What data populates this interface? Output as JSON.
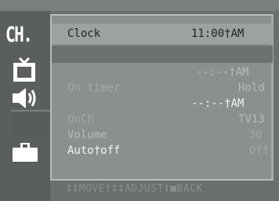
{
  "osd": {
    "category_icon_label": "CH.",
    "side_icons": [
      "tv-icon",
      "speaker-icon",
      "briefcase-icon"
    ],
    "menu": {
      "clock_label": "Clock",
      "clock_value": "11:00†AM",
      "on_time_value": "--:--†AM",
      "on_timer_label": "On timer",
      "on_timer_value": "Hold",
      "off_time_value": "--:--†AM",
      "on_ch_label": "OnCh",
      "on_ch_value": "TV13",
      "volume_label": "Volume",
      "volume_value": "30",
      "auto_off_label": "Auto†off",
      "auto_off_value": "Off"
    },
    "footer": "‡‡MOVE†‡‡ADJUST‡■BACK"
  }
}
